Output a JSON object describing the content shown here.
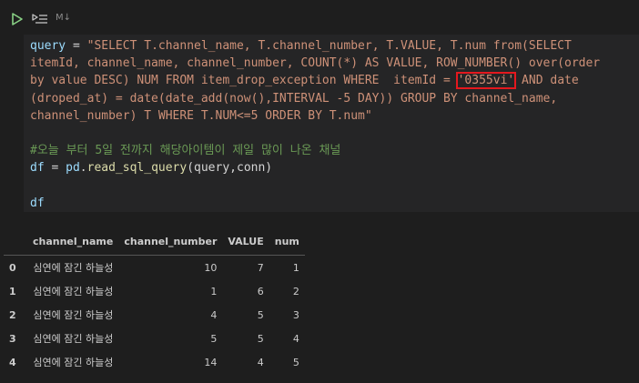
{
  "toolbar": {
    "run_icon": "play-icon",
    "run_by_line_icon": "run-by-line-icon",
    "cell_language": "M↓"
  },
  "code": {
    "line1": [
      {
        "t": "query",
        "c": "var"
      },
      {
        "t": " = ",
        "c": "op"
      },
      {
        "t": "\"SELECT T.channel_name, T.channel_number, T.VALUE, T.num from(SELECT",
        "c": "str"
      }
    ],
    "line2": "itemId, channel_name, channel_number, COUNT(*) AS VALUE, ROW_NUMBER() over(order",
    "line3_a": "by value DESC) NUM FROM item_drop_exception WHERE  itemId = ",
    "line3_highlight": "'0355vi'",
    "line3_b": " AND date",
    "line4": "(droped_at) = date(date_add(now(),INTERVAL -5 DAY)) GROUP BY channel_name,",
    "line5": "channel_number) T WHERE T.NUM<=5 ORDER BY T.num\"",
    "comment": "#오늘 부터 5일 전까지 해당아이템이 제일 많이 나온 채널",
    "df_var": "df",
    "assign": " = ",
    "pd": "pd",
    "read_fn": "read_sql_query",
    "args": "(query,conn)",
    "df_last": "df"
  },
  "output": {
    "columns": [
      "",
      "channel_name",
      "channel_number",
      "VALUE",
      "num"
    ],
    "rows": [
      [
        "0",
        "심연에 잠긴 하늘성",
        "10",
        "7",
        "1"
      ],
      [
        "1",
        "심연에 잠긴 하늘성",
        "1",
        "6",
        "2"
      ],
      [
        "2",
        "심연에 잠긴 하늘성",
        "4",
        "5",
        "3"
      ],
      [
        "3",
        "심연에 잠긴 하늘성",
        "5",
        "5",
        "4"
      ],
      [
        "4",
        "심연에 잠긴 하늘성",
        "14",
        "4",
        "5"
      ]
    ]
  },
  "colors": {
    "background": "#1e1e1e",
    "code_bg": "#252526",
    "string": "#ce9178",
    "variable": "#9cdcfe",
    "function": "#dcdcaa",
    "comment": "#6a9955",
    "highlight_box": "#e5181e",
    "run_icon": "#89d185"
  }
}
